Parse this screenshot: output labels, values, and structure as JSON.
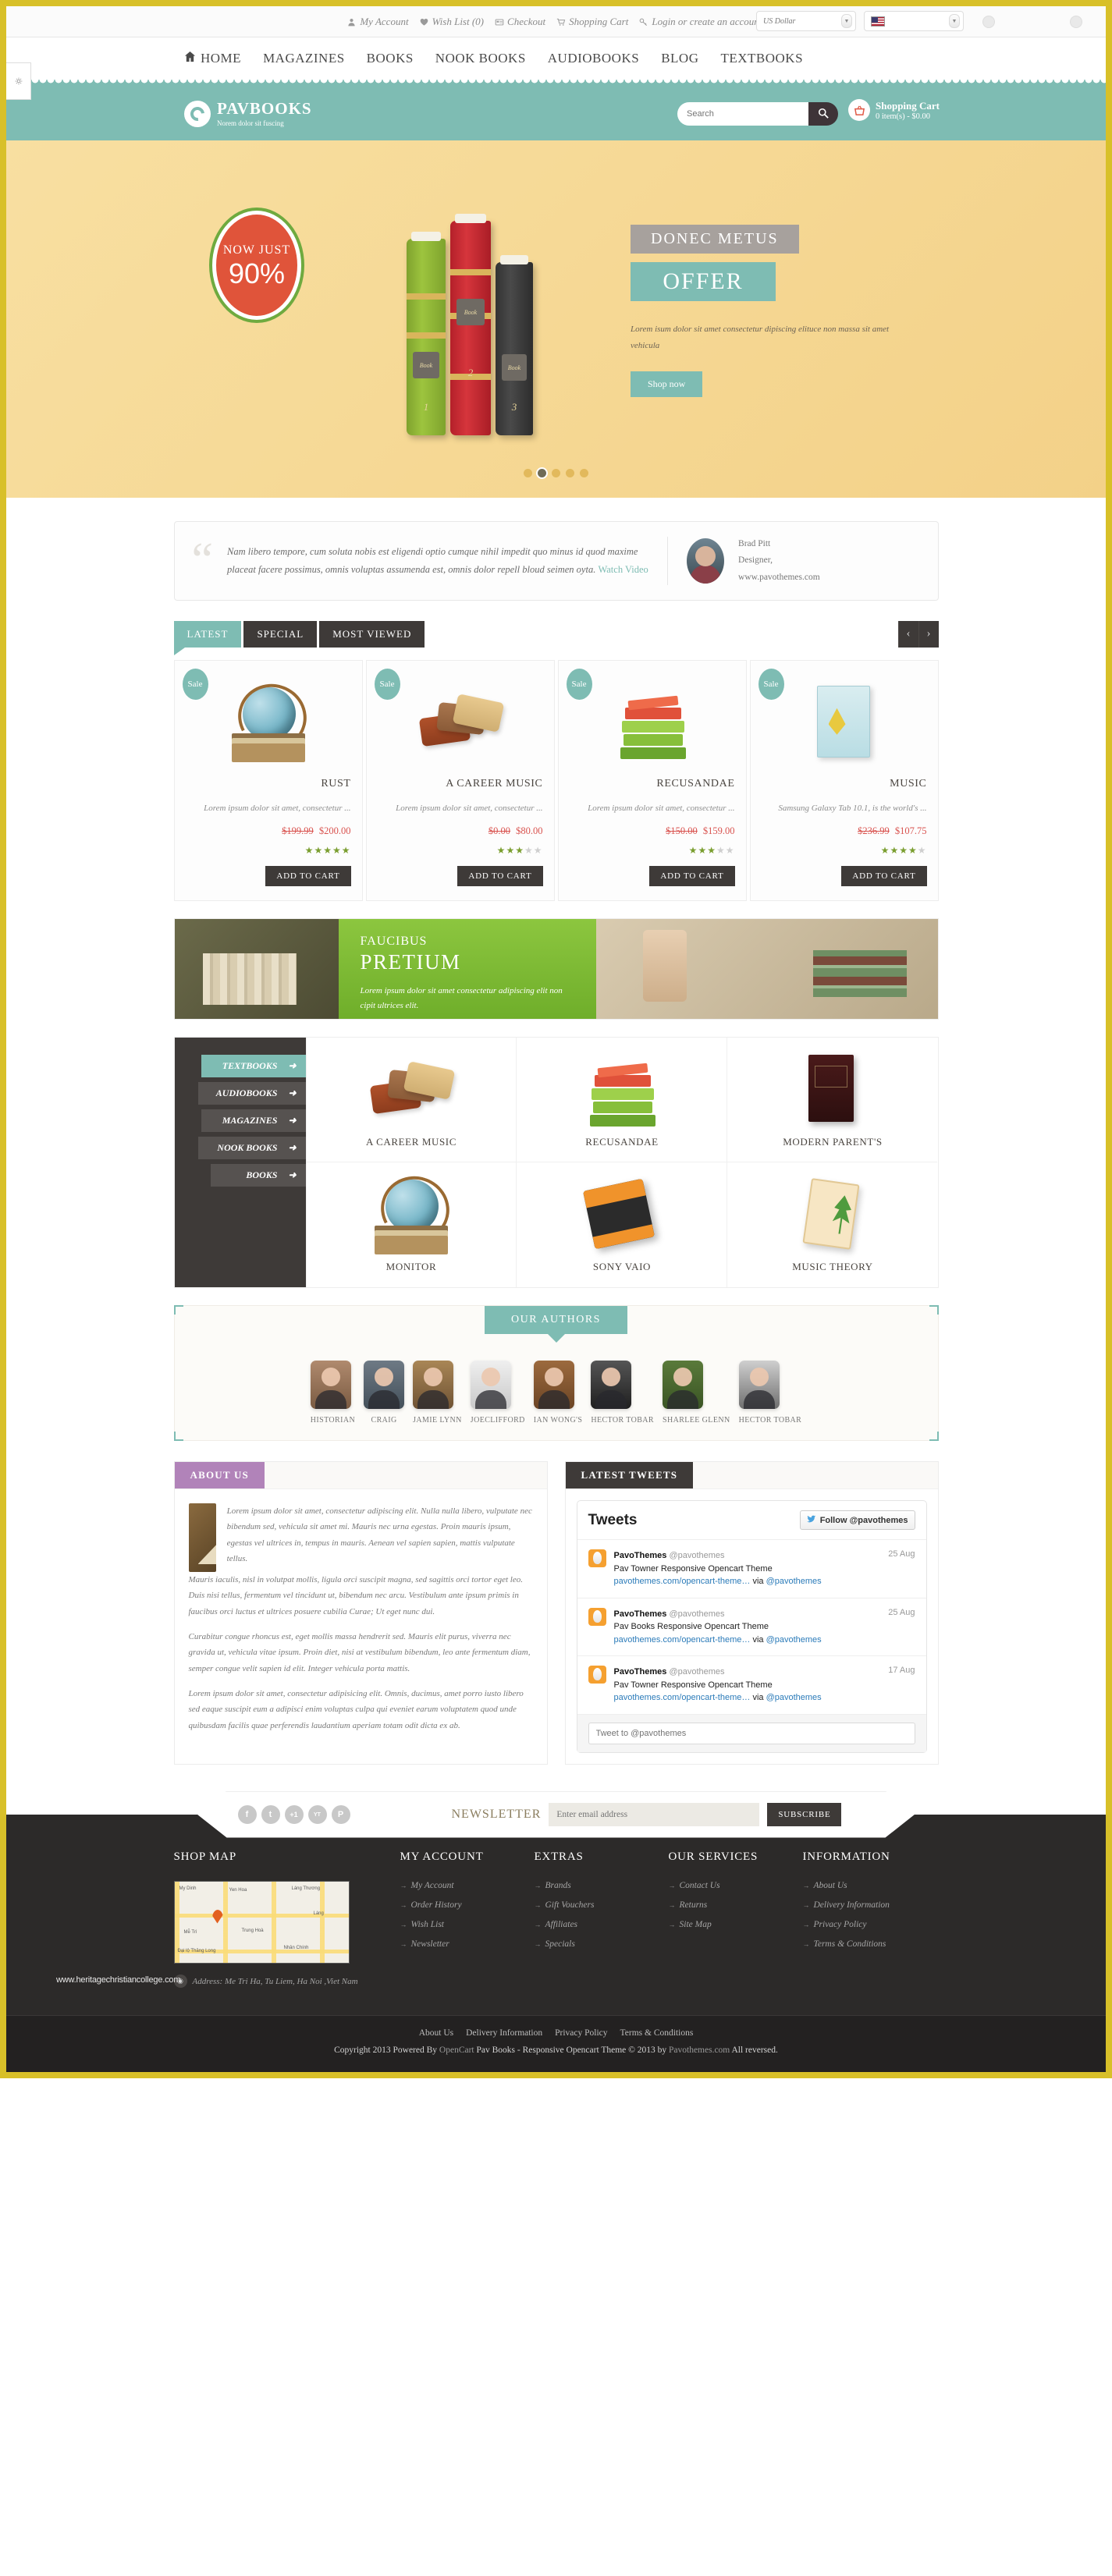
{
  "topbar": {
    "links": [
      {
        "label": "My Account",
        "icon": "user-icon"
      },
      {
        "label": "Wish List (0)",
        "icon": "heart-icon"
      },
      {
        "label": "Checkout",
        "icon": "card-icon"
      },
      {
        "label": "Shopping Cart",
        "icon": "cart-icon"
      },
      {
        "label": "Login or create an account.",
        "icon": "key-icon"
      }
    ],
    "currency": "US Dollar",
    "language": "English"
  },
  "nav": {
    "items": [
      "HOME",
      "MAGAZINES",
      "BOOKS",
      "NOOK BOOKS",
      "AUDIOBOOKS",
      "BLOG",
      "TEXTBOOKS"
    ]
  },
  "header": {
    "logo_title": "PAVBOOKS",
    "logo_tagline": "Norem dolor sit fuscing",
    "search_placeholder": "Search",
    "cart_title": "Shopping Cart",
    "cart_sub": "0 item(s) - $0.00"
  },
  "hero": {
    "badge_top": "NOW JUST",
    "badge_value": "90%",
    "heading": "DONEC METUS",
    "subheading": "OFFER",
    "desc": "Lorem isum dolor sit amet consectetur dipiscing elituce non massa sit amet vehicula",
    "button": "Shop now",
    "dots": 5,
    "active_dot": 1,
    "book_labels": [
      "Book",
      "Book",
      "Book"
    ],
    "book_numbers": [
      "1",
      "2",
      "3"
    ]
  },
  "testimonial": {
    "text": "Nam libero tempore, cum soluta nobis est eligendi optio cumque nihil impedit quo minus id quod maxime placeat facere possimus, omnis voluptas assumenda est, omnis dolor repell bloud seimen oyta.",
    "link": "Watch Video",
    "author": "Brad Pitt",
    "role": "Designer,",
    "site": "www.pavothemes.com"
  },
  "tabs": {
    "items": [
      "LATEST",
      "SPECIAL",
      "MOST VIEWED"
    ],
    "active": "LATEST",
    "prev": "‹",
    "next": "›"
  },
  "products": [
    {
      "badge": "Sale",
      "title": "RUST",
      "desc": "Lorem ipsum dolor sit amet, consectetur ...",
      "old_price": "$199.99",
      "new_price": "$200.00",
      "rating": 5,
      "button": "ADD TO CART",
      "thumb": "globe-books"
    },
    {
      "badge": "Sale",
      "title": "A CAREER MUSIC",
      "desc": "Lorem ipsum dolor sit amet, consectetur ...",
      "old_price": "$0.00",
      "new_price": "$80.00",
      "rating": 3,
      "button": "ADD TO CART",
      "thumb": "leather-wallets"
    },
    {
      "badge": "Sale",
      "title": "RECUSANDAE",
      "desc": "Lorem ipsum dolor sit amet, consectetur ...",
      "old_price": "$150.00",
      "new_price": "$159.00",
      "rating": 3,
      "button": "ADD TO CART",
      "thumb": "green-books"
    },
    {
      "badge": "Sale",
      "title": "MUSIC",
      "desc": "Samsung Galaxy Tab 10.1, is the world's ...",
      "old_price": "$236.99",
      "new_price": "$107.75",
      "rating": 4,
      "button": "ADD TO CART",
      "thumb": "simplicity-book"
    }
  ],
  "banner": {
    "kicker": "FAUCIBUS",
    "title": "PRETIUM",
    "desc": "Lorem ipsum dolor sit amet consectetur adipiscing elit non cipit ultrices elit."
  },
  "categories": {
    "sidebar": [
      "TEXTBOOKS",
      "AUDIOBOOKS",
      "MAGAZINES",
      "NOOK BOOKS",
      "BOOKS"
    ],
    "active": "TEXTBOOKS",
    "items": [
      {
        "name": "A CAREER MUSIC",
        "thumb": "leather-wallets"
      },
      {
        "name": "RECUSANDAE",
        "thumb": "green-books"
      },
      {
        "name": "MODERN PARENT'S",
        "thumb": "dark-book"
      },
      {
        "name": "MONITOR",
        "thumb": "globe-books"
      },
      {
        "name": "SONY VAIO",
        "thumb": "orange-book"
      },
      {
        "name": "MUSIC THEORY",
        "thumb": "kid-book"
      }
    ]
  },
  "authors": {
    "title": "OUR AUTHORS",
    "items": [
      {
        "name": "HISTORIAN"
      },
      {
        "name": "CRAIG"
      },
      {
        "name": "JAMIE LYNN"
      },
      {
        "name": "JOECLIFFORD"
      },
      {
        "name": "IAN WONG'S"
      },
      {
        "name": "HECTOR TOBAR"
      },
      {
        "name": "SHARLEE GLENN"
      },
      {
        "name": "HECTOR TOBAR"
      }
    ]
  },
  "about": {
    "title": "ABOUT US",
    "paragraphs": [
      "Lorem ipsum dolor sit amet, consectetur adipiscing elit. Nulla nulla libero, vulputate nec bibendum sed, vehicula sit amet mi. Mauris nec urna egestas. Proin mauris ipsum, egestas vel ultrices in, tempus in mauris. Aenean vel sapien sapien, mattis vulputate tellus.",
      "Mauris iaculis, nisl in volutpat mollis, ligula orci suscipit magna, sed sagittis orci tortor eget leo. Duis nisi tellus, fermentum vel tincidunt ut, bibendum nec arcu. Vestibulum ante ipsum primis in faucibus orci luctus et ultrices posuere cubilia Curae; Ut eget nunc dui.",
      "Curabitur congue rhoncus est, eget mollis massa hendrerit sed. Mauris elit purus, viverra nec gravida ut, vehicula vitae ipsum. Proin diet, nisi at vestibulum bibendum, leo ante fermentum diam, semper congue velit sapien id elit. Integer vehicula porta mattis.",
      "Lorem ipsum dolor sit amet, consectetur adipisicing elit. Omnis, ducimus, amet porro iusto libero sed eaque suscipit eum a adipisci enim voluptas culpa qui eveniet earum voluptatem quod unde quibusdam facilis quae perferendis laudantium aperiam totam odit dicta ex ab."
    ]
  },
  "tweets_panel": {
    "title": "LATEST TWEETS",
    "widget_title": "Tweets",
    "follow_label": "Follow @pavothemes",
    "compose_placeholder": "Tweet to @pavothemes",
    "items": [
      {
        "user": "PavoThemes",
        "handle": "@pavothemes",
        "date": "25 Aug",
        "text": "Pav Towner Responsive Opencart Theme",
        "link": "pavothemes.com/opencart-theme…",
        "via": "via",
        "mention": "@pavothemes"
      },
      {
        "user": "PavoThemes",
        "handle": "@pavothemes",
        "date": "25 Aug",
        "text": "Pav Books Responsive Opencart Theme",
        "link": "pavothemes.com/opencart-theme…",
        "via": "via",
        "mention": "@pavothemes"
      },
      {
        "user": "PavoThemes",
        "handle": "@pavothemes",
        "date": "17 Aug",
        "text": "Pav Towner Responsive Opencart Theme",
        "link": "pavothemes.com/opencart-theme…",
        "via": "via",
        "mention": "@pavothemes"
      }
    ]
  },
  "newsletter": {
    "label": "NEWSLETTER",
    "placeholder": "Enter email address",
    "button": "SUBSCRIBE",
    "social": [
      "f",
      "t",
      "+1",
      "YT",
      "P"
    ]
  },
  "footer": {
    "columns": [
      {
        "title": "SHOP MAP",
        "type": "map"
      },
      {
        "title": "MY ACCOUNT",
        "links": [
          "My Account",
          "Order History",
          "Wish List",
          "Newsletter"
        ]
      },
      {
        "title": "EXTRAS",
        "links": [
          "Brands",
          "Gift Vouchers",
          "Affiliates",
          "Specials"
        ]
      },
      {
        "title": "OUR SERVICES",
        "links": [
          "Contact Us",
          "Returns",
          "Site Map"
        ]
      },
      {
        "title": "INFORMATION",
        "links": [
          "About Us",
          "Delivery Information",
          "Privacy Policy",
          "Terms & Conditions"
        ]
      }
    ],
    "map_labels": [
      "My Dinh",
      "Yen Hoa",
      "Láng Thương",
      "Láng",
      "Mễ Trì",
      "Trung Hoà",
      "Nhân Chính",
      "Đại lộ Thăng Long"
    ],
    "address": "Address: Me Tri Ha, Tu Liem, Ha Noi ,Viet Nam",
    "bottom_links": [
      "About Us",
      "Delivery Information",
      "Privacy Policy",
      "Terms & Conditions"
    ],
    "copyright_pre": "Copyright 2013 Powered By ",
    "copyright_opencart": "OpenCart",
    "copyright_mid": " Pav Books - Responsive Opencart Theme © 2013 by ",
    "copyright_brand": "Pavothemes.com",
    "copyright_post": " All reversed.",
    "watermark": "www.heritagechristiancollege.com"
  },
  "colors": {
    "accent_teal": "#7ebcb3",
    "dark": "#3e3a38",
    "yellow_frame": "#d8c029",
    "hero_bg": "#f6d996",
    "sale_red": "#d9534f",
    "purple": "#b183b9",
    "green_banner": "#8cc63f"
  }
}
